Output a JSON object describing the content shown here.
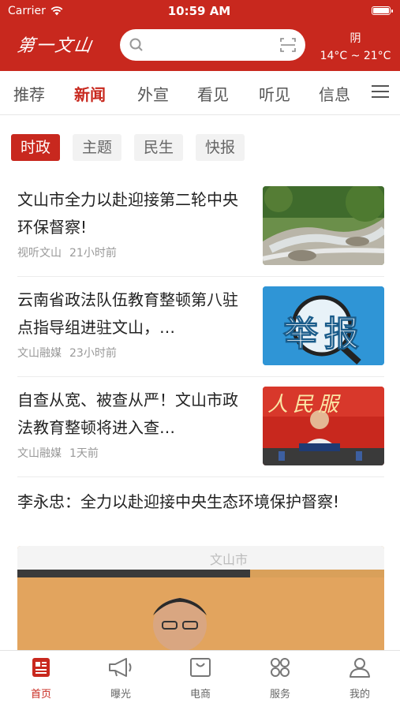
{
  "status": {
    "carrier": "Carrier",
    "time": "10:59 AM"
  },
  "header": {
    "logo_text": "第一文山",
    "search_placeholder": "",
    "weather": {
      "condition": "阴",
      "temp": "14°C ~ 21°C"
    }
  },
  "tabs": [
    {
      "label": "推荐"
    },
    {
      "label": "新闻"
    },
    {
      "label": "外宣"
    },
    {
      "label": "看见"
    },
    {
      "label": "听见"
    },
    {
      "label": "信息"
    }
  ],
  "subtabs": [
    {
      "label": "时政"
    },
    {
      "label": "主题"
    },
    {
      "label": "民生"
    },
    {
      "label": "快报"
    }
  ],
  "news": [
    {
      "title": "文山市全力以赴迎接第二轮中央环保督察!",
      "source": "视听文山",
      "time": "21小时前"
    },
    {
      "title": "云南省政法队伍教育整顿第八驻点指导组进驻文山，…",
      "source": "文山融媒",
      "time": "23小时前",
      "thumb_text": "举报"
    },
    {
      "title": "自查从宽、被查从严！文山市政法教育整顿将进入查…",
      "source": "文山融媒",
      "time": "1天前",
      "thumb_text": "人民服"
    }
  ],
  "featured": {
    "title": "李永忠：全力以赴迎接中央生态环境保护督察!",
    "banner_text": "文山市"
  },
  "bottom_nav": [
    {
      "label": "首页"
    },
    {
      "label": "曝光"
    },
    {
      "label": "电商"
    },
    {
      "label": "服务"
    },
    {
      "label": "我的"
    }
  ],
  "colors": {
    "brand": "#c8281e",
    "muted": "#999999"
  }
}
